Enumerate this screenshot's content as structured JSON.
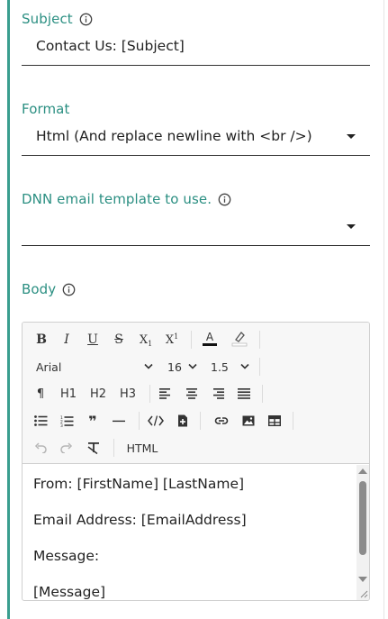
{
  "subject": {
    "label": "Subject",
    "value": "Contact Us: [Subject]"
  },
  "format": {
    "label": "Format",
    "value": "Html (And replace newline with <br />)"
  },
  "template": {
    "label": "DNN email template to use.",
    "value": ""
  },
  "body": {
    "label": "Body",
    "toolbar": {
      "font_family": "Arial",
      "font_size": "16",
      "line_height": "1.5",
      "h1": "H1",
      "h2": "H2",
      "h3": "H3",
      "html": "HTML"
    },
    "lines": [
      "From: [FirstName] [LastName]",
      "Email Address: [EmailAddress]",
      "Message:",
      "[Message]"
    ]
  },
  "colors": {
    "accent": "#3a9e8f",
    "label": "#2b8f82"
  }
}
